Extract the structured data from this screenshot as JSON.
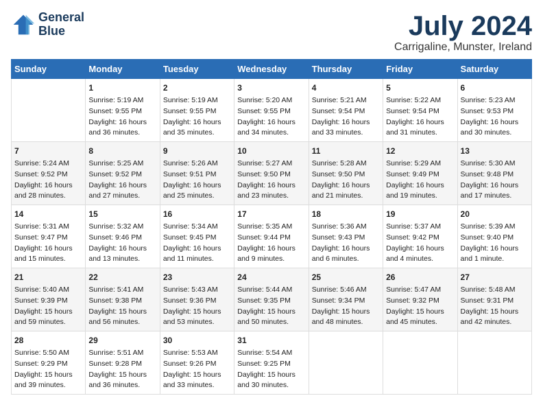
{
  "header": {
    "logo_line1": "General",
    "logo_line2": "Blue",
    "title": "July 2024",
    "subtitle": "Carrigaline, Munster, Ireland"
  },
  "days_of_week": [
    "Sunday",
    "Monday",
    "Tuesday",
    "Wednesday",
    "Thursday",
    "Friday",
    "Saturday"
  ],
  "weeks": [
    [
      {
        "day": "",
        "info": ""
      },
      {
        "day": "1",
        "info": "Sunrise: 5:19 AM\nSunset: 9:55 PM\nDaylight: 16 hours\nand 36 minutes."
      },
      {
        "day": "2",
        "info": "Sunrise: 5:19 AM\nSunset: 9:55 PM\nDaylight: 16 hours\nand 35 minutes."
      },
      {
        "day": "3",
        "info": "Sunrise: 5:20 AM\nSunset: 9:55 PM\nDaylight: 16 hours\nand 34 minutes."
      },
      {
        "day": "4",
        "info": "Sunrise: 5:21 AM\nSunset: 9:54 PM\nDaylight: 16 hours\nand 33 minutes."
      },
      {
        "day": "5",
        "info": "Sunrise: 5:22 AM\nSunset: 9:54 PM\nDaylight: 16 hours\nand 31 minutes."
      },
      {
        "day": "6",
        "info": "Sunrise: 5:23 AM\nSunset: 9:53 PM\nDaylight: 16 hours\nand 30 minutes."
      }
    ],
    [
      {
        "day": "7",
        "info": "Sunrise: 5:24 AM\nSunset: 9:52 PM\nDaylight: 16 hours\nand 28 minutes."
      },
      {
        "day": "8",
        "info": "Sunrise: 5:25 AM\nSunset: 9:52 PM\nDaylight: 16 hours\nand 27 minutes."
      },
      {
        "day": "9",
        "info": "Sunrise: 5:26 AM\nSunset: 9:51 PM\nDaylight: 16 hours\nand 25 minutes."
      },
      {
        "day": "10",
        "info": "Sunrise: 5:27 AM\nSunset: 9:50 PM\nDaylight: 16 hours\nand 23 minutes."
      },
      {
        "day": "11",
        "info": "Sunrise: 5:28 AM\nSunset: 9:50 PM\nDaylight: 16 hours\nand 21 minutes."
      },
      {
        "day": "12",
        "info": "Sunrise: 5:29 AM\nSunset: 9:49 PM\nDaylight: 16 hours\nand 19 minutes."
      },
      {
        "day": "13",
        "info": "Sunrise: 5:30 AM\nSunset: 9:48 PM\nDaylight: 16 hours\nand 17 minutes."
      }
    ],
    [
      {
        "day": "14",
        "info": "Sunrise: 5:31 AM\nSunset: 9:47 PM\nDaylight: 16 hours\nand 15 minutes."
      },
      {
        "day": "15",
        "info": "Sunrise: 5:32 AM\nSunset: 9:46 PM\nDaylight: 16 hours\nand 13 minutes."
      },
      {
        "day": "16",
        "info": "Sunrise: 5:34 AM\nSunset: 9:45 PM\nDaylight: 16 hours\nand 11 minutes."
      },
      {
        "day": "17",
        "info": "Sunrise: 5:35 AM\nSunset: 9:44 PM\nDaylight: 16 hours\nand 9 minutes."
      },
      {
        "day": "18",
        "info": "Sunrise: 5:36 AM\nSunset: 9:43 PM\nDaylight: 16 hours\nand 6 minutes."
      },
      {
        "day": "19",
        "info": "Sunrise: 5:37 AM\nSunset: 9:42 PM\nDaylight: 16 hours\nand 4 minutes."
      },
      {
        "day": "20",
        "info": "Sunrise: 5:39 AM\nSunset: 9:40 PM\nDaylight: 16 hours\nand 1 minute."
      }
    ],
    [
      {
        "day": "21",
        "info": "Sunrise: 5:40 AM\nSunset: 9:39 PM\nDaylight: 15 hours\nand 59 minutes."
      },
      {
        "day": "22",
        "info": "Sunrise: 5:41 AM\nSunset: 9:38 PM\nDaylight: 15 hours\nand 56 minutes."
      },
      {
        "day": "23",
        "info": "Sunrise: 5:43 AM\nSunset: 9:36 PM\nDaylight: 15 hours\nand 53 minutes."
      },
      {
        "day": "24",
        "info": "Sunrise: 5:44 AM\nSunset: 9:35 PM\nDaylight: 15 hours\nand 50 minutes."
      },
      {
        "day": "25",
        "info": "Sunrise: 5:46 AM\nSunset: 9:34 PM\nDaylight: 15 hours\nand 48 minutes."
      },
      {
        "day": "26",
        "info": "Sunrise: 5:47 AM\nSunset: 9:32 PM\nDaylight: 15 hours\nand 45 minutes."
      },
      {
        "day": "27",
        "info": "Sunrise: 5:48 AM\nSunset: 9:31 PM\nDaylight: 15 hours\nand 42 minutes."
      }
    ],
    [
      {
        "day": "28",
        "info": "Sunrise: 5:50 AM\nSunset: 9:29 PM\nDaylight: 15 hours\nand 39 minutes."
      },
      {
        "day": "29",
        "info": "Sunrise: 5:51 AM\nSunset: 9:28 PM\nDaylight: 15 hours\nand 36 minutes."
      },
      {
        "day": "30",
        "info": "Sunrise: 5:53 AM\nSunset: 9:26 PM\nDaylight: 15 hours\nand 33 minutes."
      },
      {
        "day": "31",
        "info": "Sunrise: 5:54 AM\nSunset: 9:25 PM\nDaylight: 15 hours\nand 30 minutes."
      },
      {
        "day": "",
        "info": ""
      },
      {
        "day": "",
        "info": ""
      },
      {
        "day": "",
        "info": ""
      }
    ]
  ]
}
